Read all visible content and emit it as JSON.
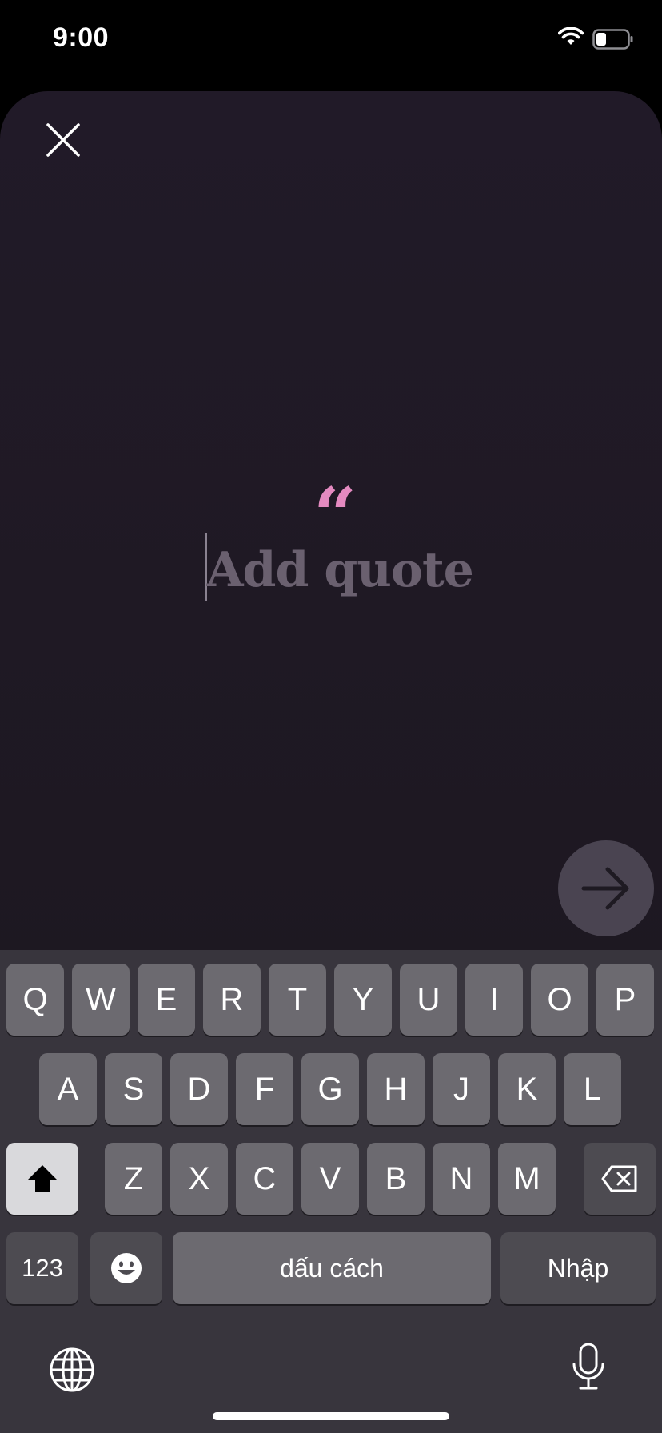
{
  "status_bar": {
    "time": "9:00"
  },
  "editor": {
    "quote_mark": "“",
    "placeholder": "Add quote",
    "value": ""
  },
  "keyboard": {
    "row1": [
      "Q",
      "W",
      "E",
      "R",
      "T",
      "Y",
      "U",
      "I",
      "O",
      "P"
    ],
    "row2": [
      "A",
      "S",
      "D",
      "F",
      "G",
      "H",
      "J",
      "K",
      "L"
    ],
    "row3": [
      "Z",
      "X",
      "C",
      "V",
      "B",
      "N",
      "M"
    ],
    "numbers_label": "123",
    "space_label": "dấu cách",
    "return_label": "Nhập"
  },
  "colors": {
    "background": "#1f1924",
    "accent_quote": "#e48ac0",
    "placeholder": "#6a606f",
    "keyboard_bg": "#38353d",
    "key": "#6c6a70"
  },
  "icons": [
    "close-icon",
    "quote-icon",
    "arrow-right-icon",
    "shift-icon",
    "backspace-icon",
    "emoji-icon",
    "globe-icon",
    "microphone-icon",
    "wifi-icon",
    "battery-icon"
  ]
}
